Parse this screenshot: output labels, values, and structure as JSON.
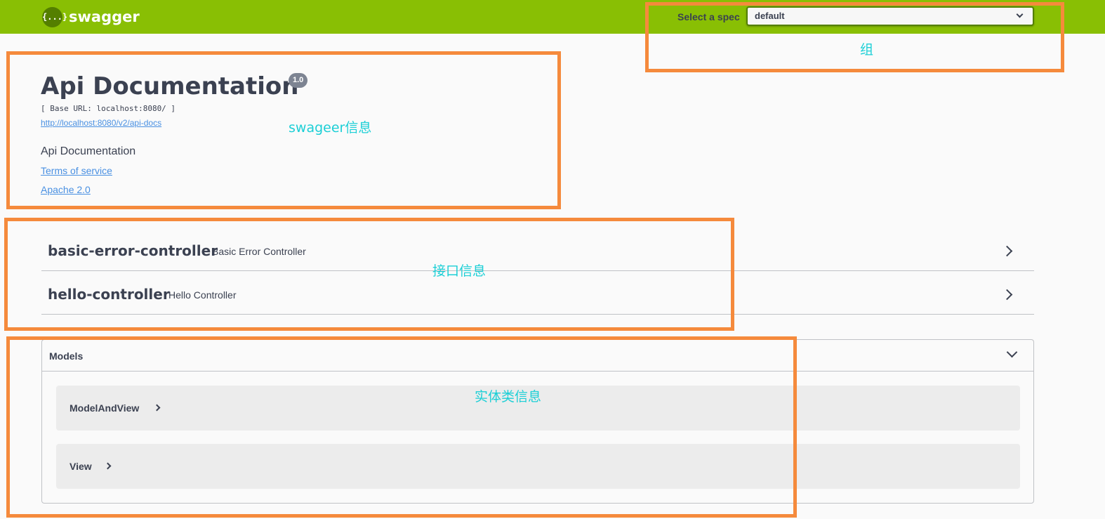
{
  "topbar": {
    "logo_glyph": "{...}",
    "logo_text": "swagger",
    "spec_label": "Select a spec",
    "spec_selected": "default",
    "bg_color": "#89bf04"
  },
  "info": {
    "title": "Api Documentation",
    "version": "1.0",
    "base_url": "[ Base URL: localhost:8080/ ]",
    "api_docs_link": "http://localhost:8080/v2/api-docs",
    "description": "Api Documentation",
    "terms_link": "Terms of service",
    "license_link": "Apache 2.0"
  },
  "controllers": [
    {
      "name": "basic-error-controller",
      "description": "Basic Error Controller"
    },
    {
      "name": "hello-controller",
      "description": "Hello Controller"
    }
  ],
  "models": {
    "title": "Models",
    "items": [
      "ModelAndView",
      "View"
    ]
  },
  "annotations": {
    "group": "组",
    "info": "swageer信息",
    "api": "接口信息",
    "models": "实体类信息",
    "box_color": "#f58a3c",
    "text_color": "#1ccfd6"
  }
}
